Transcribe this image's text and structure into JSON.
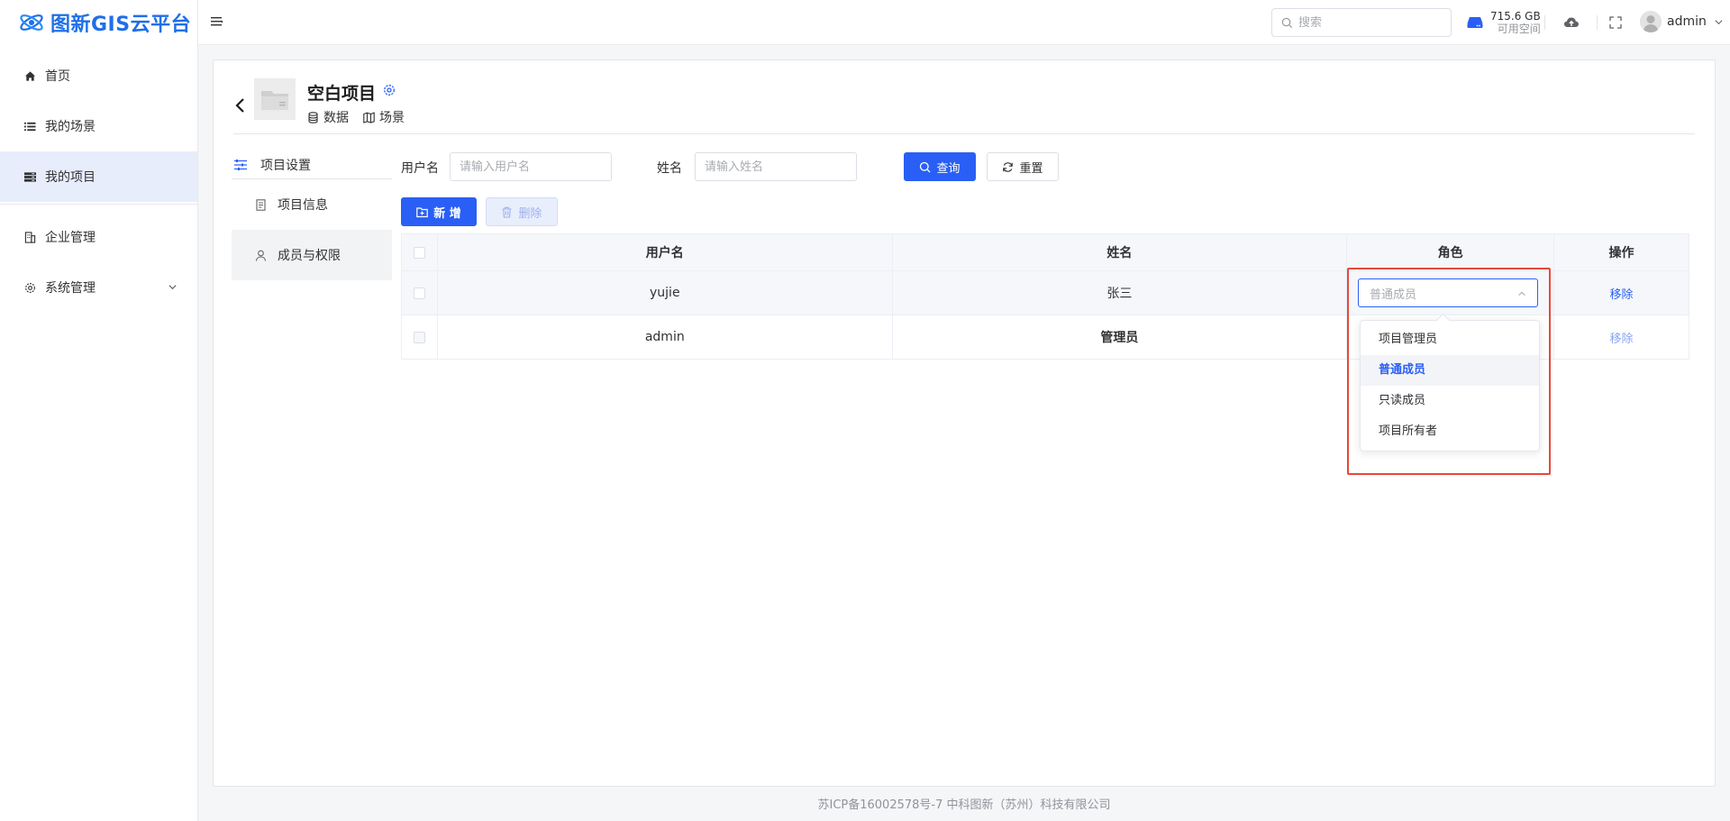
{
  "app": {
    "logo_text": "图新GIS云平台"
  },
  "sidebar": {
    "items": [
      {
        "label": "首页",
        "icon": "home-icon"
      },
      {
        "label": "我的场景",
        "icon": "list-icon"
      },
      {
        "label": "我的项目",
        "icon": "project-icon"
      },
      {
        "label": "企业管理",
        "icon": "building-icon"
      },
      {
        "label": "系统管理",
        "icon": "settings-icon"
      }
    ],
    "active": "我的项目"
  },
  "header": {
    "search_placeholder": "搜索",
    "storage_value": "715.6 GB",
    "storage_label": "可用空间",
    "user_name": "admin"
  },
  "project": {
    "title": "空白项目",
    "links": [
      "数据",
      "场景"
    ]
  },
  "settings_menu": {
    "title": "项目设置",
    "items": [
      "项目信息",
      "成员与权限"
    ],
    "active": "成员与权限"
  },
  "filters": {
    "username_label": "用户名",
    "username_placeholder": "请输入用户名",
    "name_label": "姓名",
    "name_placeholder": "请输入姓名",
    "query_button": "查询",
    "reset_button": "重置"
  },
  "actions": {
    "add_button": "新 增",
    "delete_button": "删除"
  },
  "table": {
    "columns": [
      "用户名",
      "姓名",
      "角色",
      "操作"
    ],
    "rows": [
      {
        "username": "yujie",
        "name": "张三",
        "role": "普通成员",
        "action": "移除"
      },
      {
        "username": "admin",
        "name": "管理员",
        "role": "",
        "action": "移除"
      }
    ]
  },
  "role_dropdown": {
    "selected": "普通成员",
    "options": [
      "项目管理员",
      "普通成员",
      "只读成员",
      "项目所有者"
    ]
  },
  "footer": {
    "text": "苏ICP备16002578号-7 中科图新（苏州）科技有限公司"
  },
  "colors": {
    "primary": "#2a5ff5",
    "highlight": "#e8483a",
    "logo": "#1f6fe8"
  }
}
